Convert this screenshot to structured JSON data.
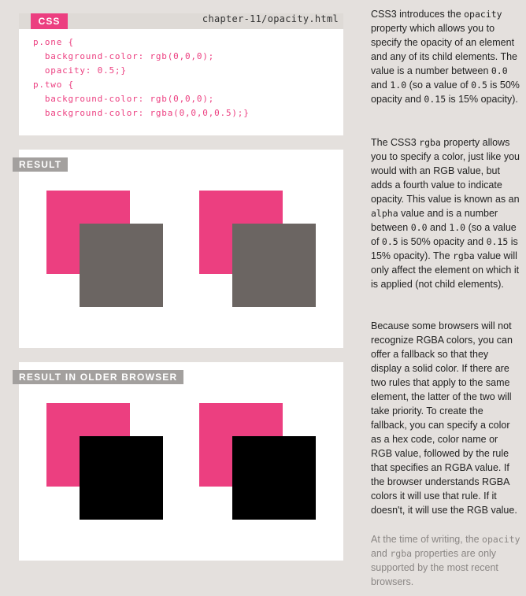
{
  "code": {
    "tag": "CSS",
    "filename": "chapter-11/opacity.html",
    "lines": [
      "p.one {",
      "  background-color: rgb(0,0,0);",
      "  opacity: 0.5;}",
      "p.two {",
      "  background-color: rgb(0,0,0);",
      "  background-color: rgba(0,0,0,0.5);}"
    ]
  },
  "results": {
    "label": "RESULT",
    "older_label": "RESULT IN OLDER BROWSER"
  },
  "colors": {
    "pink": "#ec3f80",
    "translucent_gray": "#6b6562",
    "black": "#000000"
  },
  "sidebar": {
    "p1": {
      "a": "CSS3 introduces the ",
      "m1": "opacity",
      "b": " property which allows you to specify the opacity of an element and any of its child elements. The value is a number between ",
      "m2": "0.0",
      "c": " and ",
      "m3": "1.0",
      "d": " (so a value of ",
      "m4": "0.5",
      "e": " is 50% opacity and ",
      "m5": "0.15",
      "f": " is 15% opacity)."
    },
    "p2": {
      "a": "The CSS3 ",
      "m1": "rgba",
      "b": " property allows you to specify a color, just like you would with an RGB value, but adds a fourth value to indicate opacity. This value is known as an ",
      "m2": "alpha",
      "c": " value and is a number between ",
      "m3": "0.0",
      "d": " and ",
      "m4": "1.0",
      "e": " (so a value of ",
      "m5": "0.5",
      "f": " is 50% opacity and ",
      "m6": "0.15",
      "g": " is 15% opacity). The ",
      "m7": "rgba",
      "h": " value will only affect the element on which it is applied (not child elements)."
    },
    "p3": "Because some browsers will not recognize RGBA colors, you can offer a fallback so that they display a solid color. If there are two rules that apply to the same element, the latter of the two will take priority. To create the fallback, you can specify a color as a hex code, color name or RGB value, followed by the rule that specifies an RGBA value. If the browser understands RGBA colors it will use that rule. If it doesn't, it will use the RGB value.",
    "p4": {
      "a": "At the time of writing, the ",
      "m1": "opacity",
      "b": " and ",
      "m2": "rgba",
      "c": " properties are only supported by the most recent browsers."
    }
  }
}
